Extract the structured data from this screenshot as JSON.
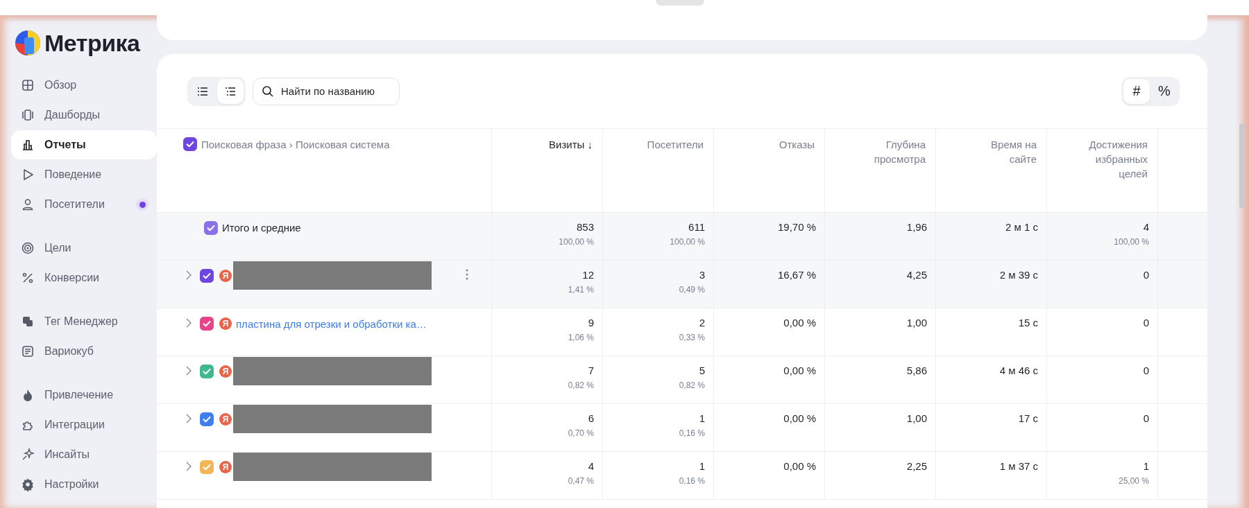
{
  "logo": {
    "text": "Метрика"
  },
  "nav_groups": [
    [
      {
        "label": "Обзор",
        "selected": false,
        "notification": false
      },
      {
        "label": "Дашборды",
        "selected": false,
        "notification": false
      },
      {
        "label": "Отчеты",
        "selected": true,
        "notification": false
      },
      {
        "label": "Поведение",
        "selected": false,
        "notification": false
      },
      {
        "label": "Посетители",
        "selected": false,
        "notification": true
      }
    ],
    [
      {
        "label": "Цели",
        "selected": false,
        "notification": false
      },
      {
        "label": "Конверсии",
        "selected": false,
        "notification": false
      }
    ],
    [
      {
        "label": "Тег Менеджер",
        "selected": false,
        "notification": false
      },
      {
        "label": "Вариокуб",
        "selected": false,
        "notification": false
      }
    ],
    [
      {
        "label": "Привлечение",
        "selected": false,
        "notification": false
      },
      {
        "label": "Интеграции",
        "selected": false,
        "notification": false
      },
      {
        "label": "Инсайты",
        "selected": false,
        "notification": false
      },
      {
        "label": "Настройки",
        "selected": false,
        "notification": false
      }
    ]
  ],
  "toolbar": {
    "view_modes": [
      {
        "kind": "flat",
        "selected": false
      },
      {
        "kind": "tree",
        "selected": true
      }
    ],
    "search": {
      "placeholder": "Найти по названию"
    },
    "units": [
      {
        "label": "#",
        "selected": true
      },
      {
        "label": "%",
        "selected": false
      }
    ]
  },
  "table": {
    "dimension": {
      "label": "Поисковая фраза › Поисковая система",
      "checked": true
    },
    "columns": [
      {
        "label": "Визиты",
        "sorted": true,
        "sort_arrow": "↓"
      },
      {
        "label": "Посетители",
        "sorted": false
      },
      {
        "label": "Отказы",
        "sorted": false
      },
      {
        "label": "Глубина просмотра",
        "sorted": false
      },
      {
        "label": "Время на сайте",
        "sorted": false
      },
      {
        "label": "Достижения избранных целей",
        "sorted": false
      }
    ],
    "total": {
      "label": "Итого и средние",
      "checked": true,
      "cells": [
        {
          "value": "853",
          "share": "100,00 %"
        },
        {
          "value": "611",
          "share": "100,00 %"
        },
        {
          "value": "19,70 %"
        },
        {
          "value": "1,96"
        },
        {
          "value": "2 м 1 с"
        },
        {
          "value": "4",
          "share": "100,00 %"
        }
      ]
    },
    "rows": [
      {
        "redacted": true,
        "checked": true,
        "color": "#6f45e0",
        "engine": "Я",
        "highlighted": true,
        "cells": [
          {
            "value": "12",
            "share": "1,41 %"
          },
          {
            "value": "3",
            "share": "0,49 %"
          },
          {
            "value": "16,67 %"
          },
          {
            "value": "4,25"
          },
          {
            "value": "2 м 39 с"
          },
          {
            "value": "0"
          }
        ]
      },
      {
        "redacted": false,
        "phrase": "пластина для отрезки и обработки ка…",
        "checked": true,
        "color": "#e6458c",
        "engine": "Я",
        "highlighted": false,
        "cells": [
          {
            "value": "9",
            "share": "1,06 %"
          },
          {
            "value": "2",
            "share": "0,33 %"
          },
          {
            "value": "0,00 %"
          },
          {
            "value": "1,00"
          },
          {
            "value": "15 с"
          },
          {
            "value": "0"
          }
        ]
      },
      {
        "redacted": true,
        "checked": true,
        "color": "#3fb88f",
        "engine": "Я",
        "highlighted": false,
        "cells": [
          {
            "value": "7",
            "share": "0,82 %"
          },
          {
            "value": "5",
            "share": "0,82 %"
          },
          {
            "value": "0,00 %"
          },
          {
            "value": "5,86"
          },
          {
            "value": "4 м 46 с"
          },
          {
            "value": "0"
          }
        ]
      },
      {
        "redacted": true,
        "checked": true,
        "color": "#3f7ff0",
        "engine": "Я",
        "highlighted": false,
        "cells": [
          {
            "value": "6",
            "share": "0,70 %"
          },
          {
            "value": "1",
            "share": "0,16 %"
          },
          {
            "value": "0,00 %"
          },
          {
            "value": "1,00"
          },
          {
            "value": "17 с"
          },
          {
            "value": "0"
          }
        ]
      },
      {
        "redacted": true,
        "checked": true,
        "color": "#f3b656",
        "engine": "Я",
        "highlighted": false,
        "cells": [
          {
            "value": "4",
            "share": "0,47 %"
          },
          {
            "value": "1",
            "share": "0,16 %"
          },
          {
            "value": "0,00 %"
          },
          {
            "value": "2,25"
          },
          {
            "value": "1 м 37 с"
          },
          {
            "value": "1",
            "share": "25,00 %"
          }
        ]
      }
    ]
  }
}
